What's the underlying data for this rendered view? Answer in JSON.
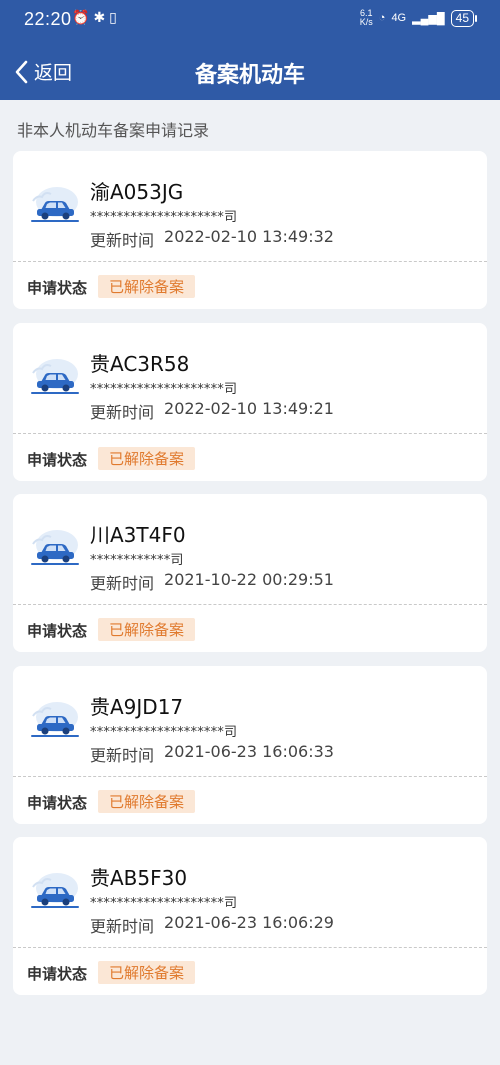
{
  "status_bar": {
    "time": "22:20",
    "net_speed_top": "6.1",
    "net_speed_bottom": "K/s",
    "network": "4G",
    "battery": "45"
  },
  "navbar": {
    "back_label": "返回",
    "title": "备案机动车"
  },
  "section_title": "非本人机动车备案申请记录",
  "labels": {
    "updated_prefix": "更新时间",
    "status_label": "申请状态"
  },
  "records": [
    {
      "plate": "渝A053JG",
      "owner": "********************司",
      "updated_time": "2022-02-10 13:49:32",
      "status": "已解除备案"
    },
    {
      "plate": "贵AC3R58",
      "owner": "********************司",
      "updated_time": "2022-02-10 13:49:21",
      "status": "已解除备案"
    },
    {
      "plate": "川A3T4F0",
      "owner": "************司",
      "updated_time": "2021-10-22 00:29:51",
      "status": "已解除备案"
    },
    {
      "plate": "贵A9JD17",
      "owner": "********************司",
      "updated_time": "2021-06-23 16:06:33",
      "status": "已解除备案"
    },
    {
      "plate": "贵AB5F30",
      "owner": "********************司",
      "updated_time": "2021-06-23 16:06:29",
      "status": "已解除备案"
    }
  ],
  "colors": {
    "header_bg": "#2f5aa6",
    "status_badge_bg": "#fbe7d6",
    "status_badge_text": "#e07a2e",
    "page_bg": "#eef1f5"
  },
  "icons": {
    "back": "chevron-left-icon",
    "car": "car-icon"
  }
}
